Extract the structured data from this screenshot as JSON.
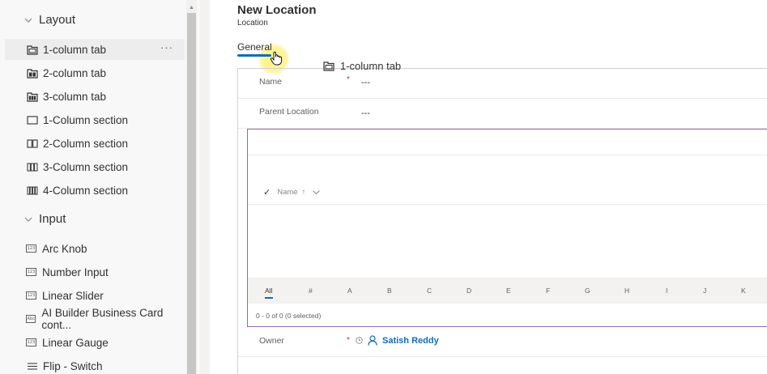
{
  "sidebar": {
    "groups": [
      {
        "label": "Layout",
        "items": [
          {
            "label": "1-column tab",
            "icon": "tab-1-icon"
          },
          {
            "label": "2-column tab",
            "icon": "tab-2-icon"
          },
          {
            "label": "3-column tab",
            "icon": "tab-3-icon"
          },
          {
            "label": "1-Column section",
            "icon": "section-1-icon"
          },
          {
            "label": "2-Column section",
            "icon": "section-2-icon"
          },
          {
            "label": "3-Column section",
            "icon": "section-3-icon"
          },
          {
            "label": "4-Column section",
            "icon": "section-4-icon"
          }
        ]
      },
      {
        "label": "Input",
        "items": [
          {
            "label": "Arc Knob",
            "icon": "number-badge-icon",
            "badge": "123"
          },
          {
            "label": "Number Input",
            "icon": "number-badge-icon",
            "badge": "123"
          },
          {
            "label": "Linear Slider",
            "icon": "number-badge-icon",
            "badge": "123"
          },
          {
            "label": "AI Builder Business Card cont...",
            "icon": "text-badge-icon",
            "badge": "Abc"
          },
          {
            "label": "Linear Gauge",
            "icon": "number-badge-icon",
            "badge": "123"
          },
          {
            "label": "Flip - Switch",
            "icon": "list-icon"
          }
        ]
      }
    ],
    "more_label": "···"
  },
  "form": {
    "title": "New Location",
    "entity": "Location",
    "tab": "General",
    "drag_ghost_label": "1-column tab",
    "fields": [
      {
        "label": "Name",
        "required_marker": "*",
        "value": "---"
      },
      {
        "label": "Parent Location",
        "value": "---"
      }
    ],
    "subgrid": {
      "check_glyph": "✓",
      "column": "Name",
      "sort_glyph": "↑",
      "alpha": [
        "All",
        "#",
        "A",
        "B",
        "C",
        "D",
        "E",
        "F",
        "G",
        "H",
        "I",
        "J",
        "K"
      ],
      "footer": "0 - 0 of 0 (0 selected)"
    },
    "owner": {
      "label": "Owner",
      "required_marker": "*",
      "name": "Satish Reddy"
    }
  },
  "colors": {
    "accent": "#0f6cbd",
    "subgrid_border": "#8a6bb0",
    "required": "#c4314b"
  }
}
